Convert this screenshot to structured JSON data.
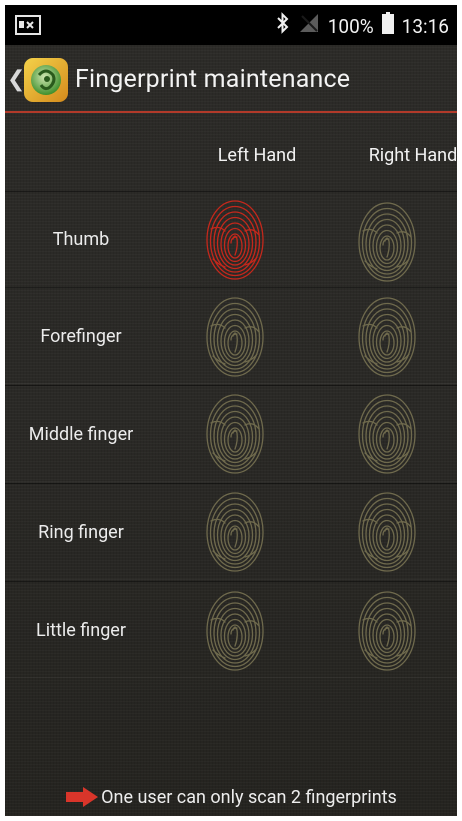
{
  "status_bar": {
    "notification_icon": "contact-card-icon",
    "bluetooth_icon": "bluetooth-icon",
    "signal_icon": "no-signal-icon",
    "battery_text": "100%",
    "time": "13:16"
  },
  "header": {
    "title": "Fingerprint maintenance",
    "app_icon": "fingerprint-app-icon"
  },
  "columns": [
    "Left Hand",
    "Right Hand"
  ],
  "fingers": [
    {
      "label": "Thumb",
      "left": "enrolled",
      "right": "not-enrolled"
    },
    {
      "label": "Forefinger",
      "left": "not-enrolled",
      "right": "not-enrolled"
    },
    {
      "label": "Middle finger",
      "left": "not-enrolled",
      "right": "not-enrolled"
    },
    {
      "label": "Ring finger",
      "left": "not-enrolled",
      "right": "not-enrolled"
    },
    {
      "label": "Little finger",
      "left": "not-enrolled",
      "right": "not-enrolled"
    }
  ],
  "footer": {
    "note": "One user can only scan 2 fingerprints",
    "icon": "right-arrow-icon"
  },
  "colors": {
    "accent_line": "#b23a2a",
    "enrolled": "#c4281c",
    "not_enrolled": "#6f6a4d",
    "arrow": "#d9352a"
  }
}
